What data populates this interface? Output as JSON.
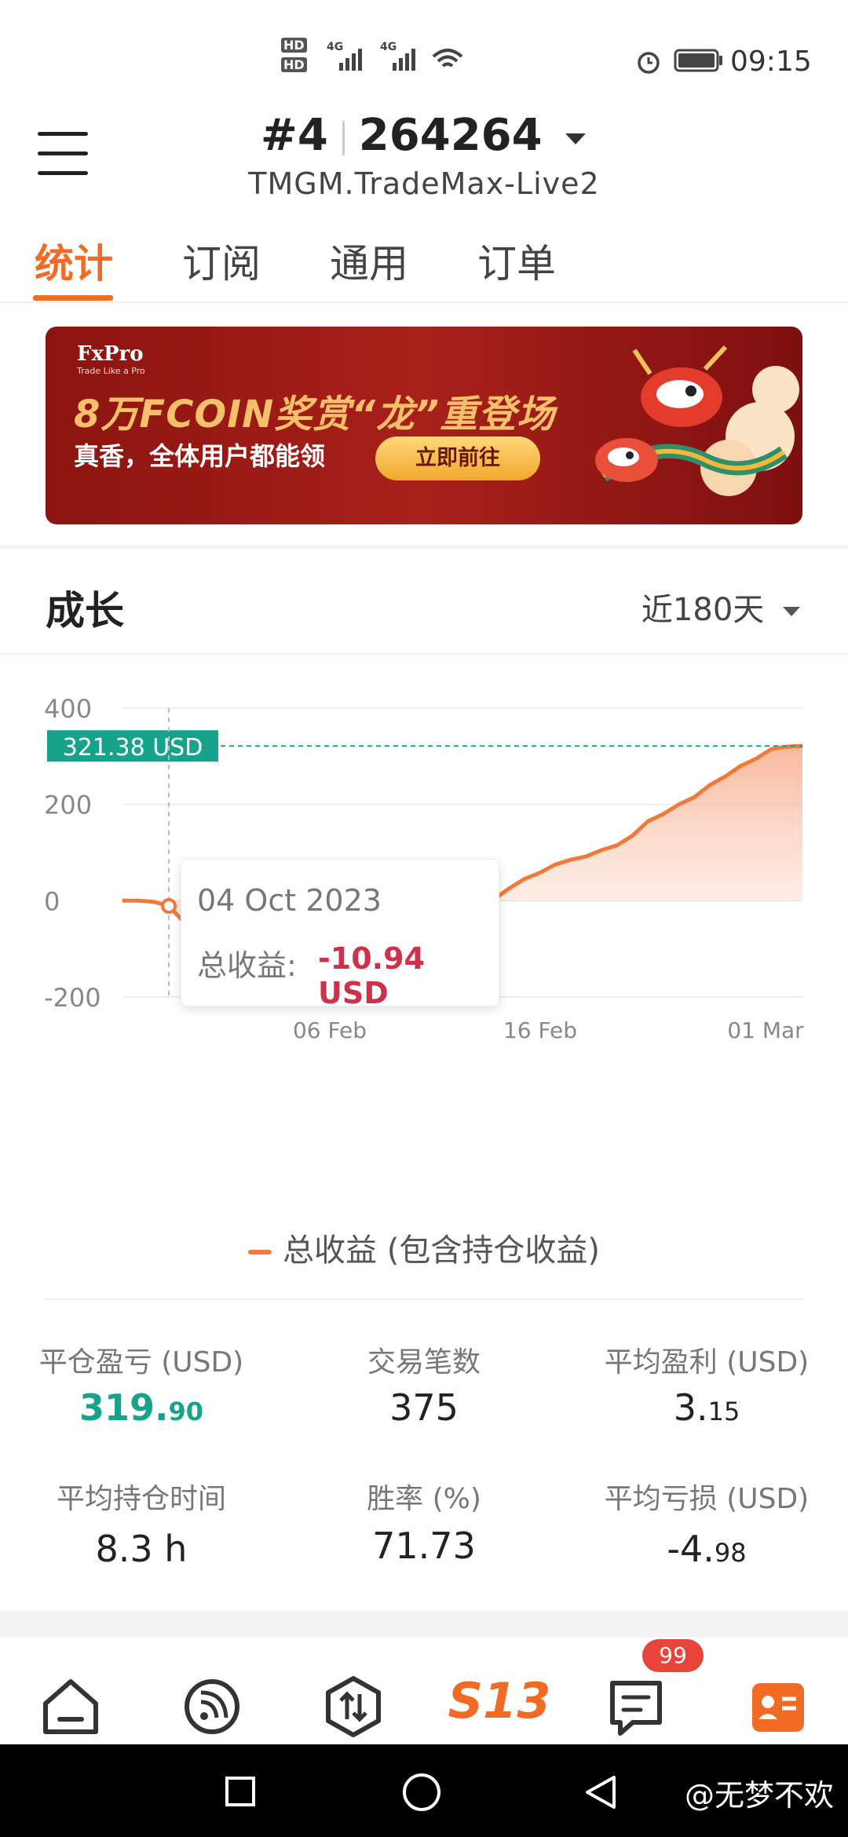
{
  "status_bar": {
    "time": "09:15",
    "hd1": "HD",
    "hd2": "HD",
    "net1": "4G",
    "net2": "4G"
  },
  "header": {
    "account_prefix": "#4",
    "account_number": "264264",
    "server": "TMGM.TradeMax-Live2"
  },
  "tabs": [
    {
      "label": "统计",
      "active": true
    },
    {
      "label": "订阅",
      "active": false
    },
    {
      "label": "通用",
      "active": false
    },
    {
      "label": "订单",
      "active": false
    }
  ],
  "banner": {
    "brand": "FxPro",
    "brand_sub": "Trade Like a Pro",
    "headline": "8万FCOIN奖赏“龙”重登场",
    "sub": "真香，全体用户都能领",
    "cta": "立即前往"
  },
  "growth": {
    "title": "成长",
    "range_label": "近180天"
  },
  "chart_data": {
    "type": "area",
    "title": "",
    "xlabel": "",
    "ylabel": "",
    "ylim": [
      -200,
      400
    ],
    "yticks": [
      "400",
      "200",
      "0",
      "-200"
    ],
    "xticks": [
      "06 Feb",
      "16 Feb",
      "01 Mar"
    ],
    "current_value_label": "321.38 USD",
    "current_value": 321.38,
    "series": [
      {
        "name": "总收益 (包含持仓收益)",
        "color": "#f07a3a",
        "values": [
          0,
          0,
          -2,
          -10.94,
          -45,
          -48,
          -44,
          -46,
          -45,
          -80,
          -75,
          -70,
          -68,
          -75,
          -65,
          -5,
          -45,
          -50,
          -35,
          -28,
          -18,
          -10,
          -2,
          0,
          2,
          25,
          45,
          58,
          75,
          85,
          92,
          105,
          115,
          135,
          165,
          180,
          200,
          215,
          240,
          258,
          280,
          295,
          315,
          320,
          321.38
        ]
      }
    ]
  },
  "tooltip": {
    "date": "04 Oct 2023",
    "label": "总收益:",
    "value": "-10.94 USD"
  },
  "legend": {
    "label": "总收益 (包含持仓收益)"
  },
  "stats": {
    "closed_pl": {
      "label": "平仓盈亏 (USD)",
      "int": "319.",
      "dec": "90"
    },
    "trades": {
      "label": "交易笔数",
      "value": "375"
    },
    "avg_profit": {
      "label": "平均盈利 (USD)",
      "int": "3.",
      "dec": "15"
    },
    "avg_hold": {
      "label": "平均持仓时间",
      "value": "8.3 h"
    },
    "win_rate": {
      "label": "胜率 (%)",
      "value": "71.73"
    },
    "avg_loss": {
      "label": "平均亏损 (USD)",
      "int": "-4.",
      "dec": "98"
    }
  },
  "bottom_nav": {
    "center_logo": "S13",
    "badge": "99"
  },
  "watermark": "@无梦不欢"
}
